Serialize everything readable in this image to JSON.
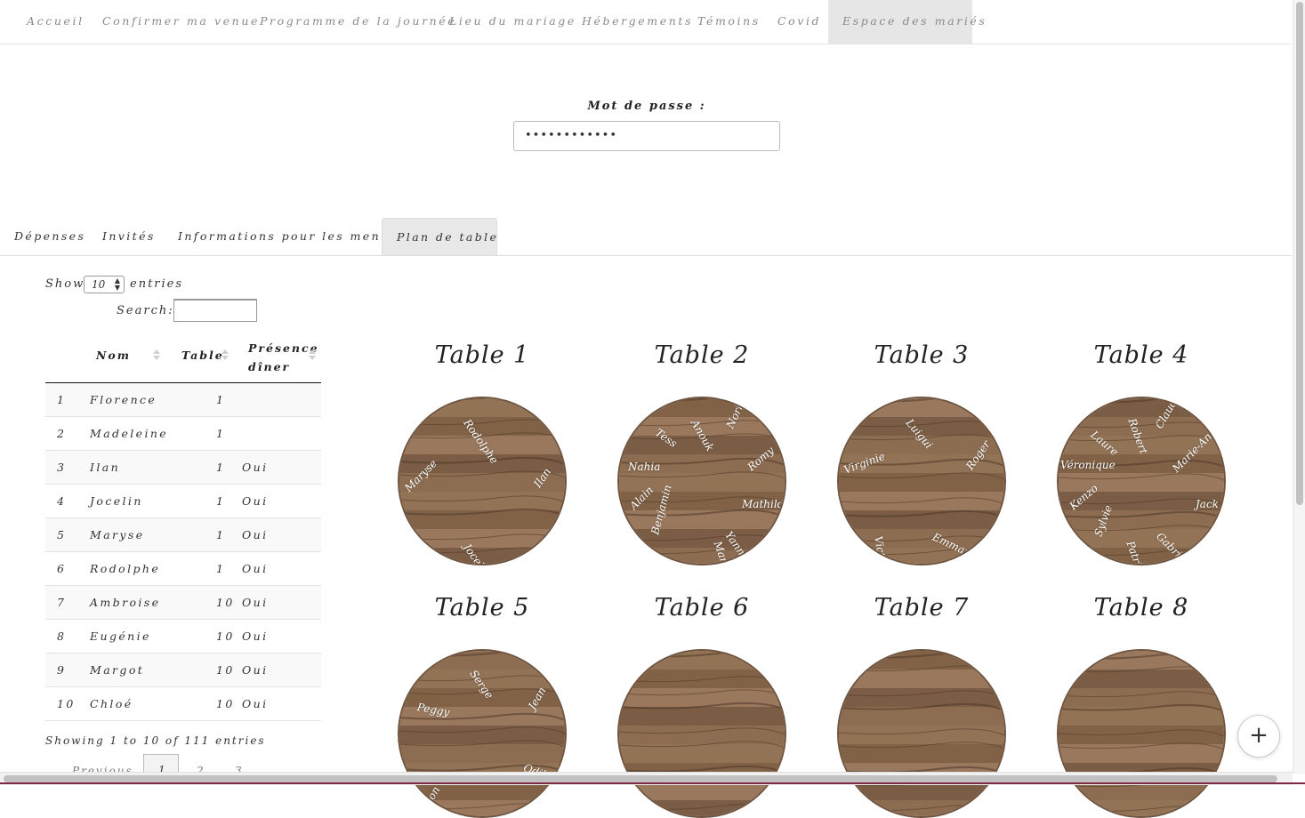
{
  "nav": {
    "items": [
      "Accueil",
      "Confirmer ma venue",
      "Programme de la journée",
      "Lieu du mariage",
      "Hébergements",
      "Témoins",
      "Covid",
      "Espace des mariés"
    ],
    "active_index": 7
  },
  "password": {
    "label": "Mot de passe :",
    "value": "••••••••••••"
  },
  "tabs": {
    "items": [
      "Dépenses",
      "Invités",
      "Informations pour les menus",
      "Plan de table"
    ],
    "active_index": 3
  },
  "table_controls": {
    "show_label": "Show",
    "entries_value": "10",
    "entries_label": "entries",
    "search_label": "Search:",
    "search_value": ""
  },
  "guest_table": {
    "columns": [
      "",
      "Nom",
      "Table",
      "Présence dîner"
    ],
    "rows": [
      [
        "1",
        "Florence",
        "1",
        ""
      ],
      [
        "2",
        "Madeleine",
        "1",
        ""
      ],
      [
        "3",
        "Ilan",
        "1",
        "Oui"
      ],
      [
        "4",
        "Jocelin",
        "1",
        "Oui"
      ],
      [
        "5",
        "Maryse",
        "1",
        "Oui"
      ],
      [
        "6",
        "Rodolphe",
        "1",
        "Oui"
      ],
      [
        "7",
        "Ambroise",
        "10",
        "Oui"
      ],
      [
        "8",
        "Eugénie",
        "10",
        "Oui"
      ],
      [
        "9",
        "Margot",
        "10",
        "Oui"
      ],
      [
        "10",
        "Chloé",
        "10",
        "Oui"
      ]
    ],
    "info": "Showing 1 to 10 of 111 entries",
    "pager": {
      "previous": "Previous",
      "pages": [
        "1",
        "2",
        "3"
      ],
      "current": "1"
    }
  },
  "seating_plan": {
    "tables": [
      {
        "name": "Table 1",
        "guests": [
          "Rodolphe",
          "Maryse",
          "Ilan",
          "Jocelin"
        ]
      },
      {
        "name": "Table 2",
        "guests": [
          "Tess",
          "Anouk",
          "Norbert",
          "Romy",
          "Nahia",
          "Alain",
          "Mathilde",
          "Benjamin",
          "Marine",
          "Yann"
        ]
      },
      {
        "name": "Table 3",
        "guests": [
          "Luigui",
          "Virginie",
          "Roger",
          "Victor",
          "Emmanuel"
        ]
      },
      {
        "name": "Table 4",
        "guests": [
          "Laure",
          "Robert",
          "Claude",
          "Véronique",
          "Marie-Ann",
          "Kenzo",
          "Jack",
          "Sylvie",
          "Patrick",
          "Gabrielle"
        ]
      },
      {
        "name": "Table 5",
        "guests": [
          "Serge",
          "Peggy",
          "Jean",
          "Aaron",
          "Odile"
        ]
      },
      {
        "name": "Table 6",
        "guests": []
      },
      {
        "name": "Table 7",
        "guests": []
      },
      {
        "name": "Table 8",
        "guests": []
      }
    ]
  },
  "fab": {
    "icon": "plus-icon",
    "label": "+"
  },
  "colors": {
    "nav_active_bg": "#e6e6e6",
    "wood": "#8b6a4f",
    "wood_border": "#6f543f",
    "scrollbar_accent": "#7d2a40"
  }
}
